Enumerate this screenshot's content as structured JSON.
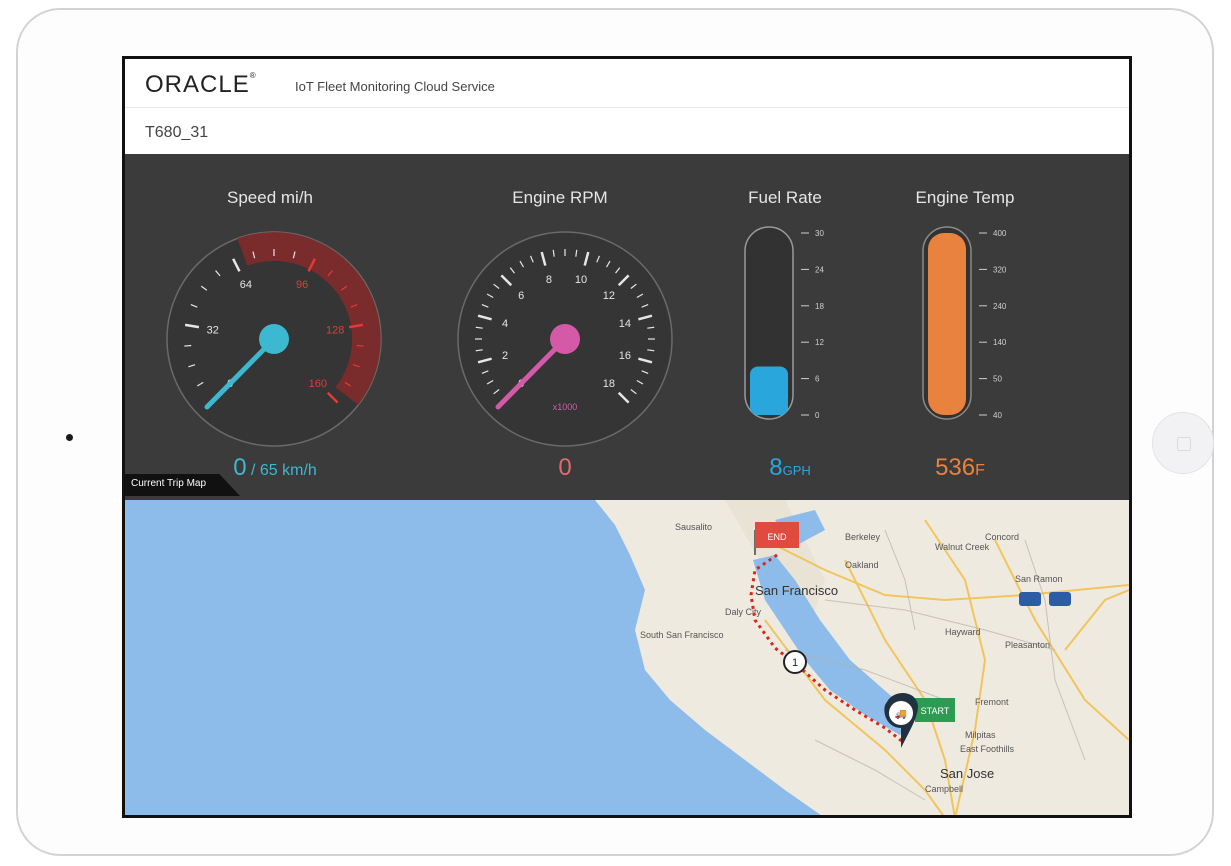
{
  "app": {
    "logo": "ORACLE",
    "logo_mark": "®",
    "service_name": "IoT Fleet Monitoring Cloud Service",
    "vehicle_id": "T680_31"
  },
  "gauges": {
    "speed": {
      "title": "Speed mi/h",
      "value": 0,
      "value_text": "0",
      "unit_text": "65 km/h",
      "ticks": [
        "0",
        "32",
        "64",
        "96",
        "128",
        "160"
      ],
      "color": "#3cb8d0",
      "redzone_color": "#7a2b2b",
      "tick_red_color": "#e13a3a"
    },
    "rpm": {
      "title": "Engine RPM",
      "value": 0,
      "value_text": "0",
      "ticks": [
        "0",
        "2",
        "4",
        "6",
        "8",
        "10",
        "12",
        "14",
        "16",
        "18"
      ],
      "sub_label": "x1000",
      "color": "#d45aa8"
    },
    "fuel": {
      "title": "Fuel Rate",
      "value": 8,
      "value_text": "8",
      "unit": "GPH",
      "ticks": [
        "0",
        "6",
        "12",
        "18",
        "24",
        "30"
      ],
      "max": 30,
      "color": "#29a7dc"
    },
    "temp": {
      "title": "Engine Temp",
      "value": 536,
      "value_text": "536",
      "unit": "F",
      "ticks": [
        "40",
        "50",
        "140",
        "240",
        "320",
        "400"
      ],
      "color": "#e8823e"
    }
  },
  "map": {
    "tab_label": "Current Trip Map",
    "end_flag": "END",
    "start_flag": "START",
    "stop_number": "1",
    "current_marker": "🚚",
    "place_labels": {
      "san_francisco": "San Francisco",
      "san_jose": "San Jose",
      "south_sf": "South San Francisco",
      "daly": "Daly City",
      "pleasanton": "Pleasanton",
      "fremont": "Fremont",
      "hayward": "Hayward",
      "san_ramon": "San Ramon",
      "concord": "Concord",
      "walnut": "Walnut Creek",
      "berkeley": "Berkeley",
      "oakland": "Oakland",
      "milpitas": "Milpitas",
      "east_foothills": "East Foothills",
      "sausalito": "Sausalito",
      "campbell": "Campbell"
    },
    "route_color": "#d9261c",
    "end_color": "#e04a3f",
    "start_color": "#2e9b52"
  }
}
